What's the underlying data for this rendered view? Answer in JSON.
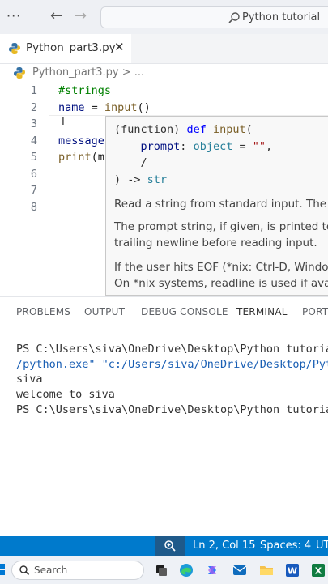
{
  "titlebar": {
    "menu_icon": "ellipsis-icon",
    "back_icon": "back-arrow-icon",
    "forward_icon": "forward-arrow-icon",
    "command_center_text": "Python tutorial"
  },
  "tabs": [
    {
      "label": "Python_part3.py",
      "active": true,
      "icon": "python-file-icon"
    }
  ],
  "breadcrumb": {
    "file": "Python_part3.py",
    "more": "> ..."
  },
  "editor": {
    "line_numbers": [
      "1",
      "2",
      "3",
      "4",
      "5",
      "6",
      "7",
      "8"
    ],
    "lines": {
      "l1": "#strings",
      "l2_var": "name",
      "l2_op": " = ",
      "l2_fn": "input",
      "l2_paren": "()",
      "l4": "message",
      "l5_fn": "print",
      "l5_rest": "(m"
    },
    "cursor_line": 2,
    "cursor_col": 15
  },
  "hover": {
    "sig": {
      "open_paren": "(",
      "kind": "function",
      "close_kind": ") ",
      "def_kw": "def",
      "fn_name": "input",
      "open": "(",
      "indent": "    ",
      "param": "prompt",
      "colon": ": ",
      "param_type": "object",
      "eq": " = ",
      "default": "\"\"",
      "comma": ",",
      "slash": "/",
      "close": ") -> ",
      "ret": "str"
    },
    "doc": [
      "Read a string from standard input. The t",
      "The prompt string, if given, is printed to",
      "trailing newline before reading input.",
      "If the user hits EOF (*nix: Ctrl-D, Window",
      "On *nix systems, readline is used if avail"
    ]
  },
  "panel": {
    "tabs": [
      "PROBLEMS",
      "OUTPUT",
      "DEBUG CONSOLE",
      "TERMINAL",
      "PORTS"
    ],
    "active_tab": "TERMINAL",
    "terminal": [
      "PS C:\\Users\\siva\\OneDrive\\Desktop\\Python tutoria",
      "/python.exe\" \"c:/Users/siva/OneDrive/Desktop/Pyt",
      "siva",
      "welcome to siva",
      "PS C:\\Users\\siva\\OneDrive\\Desktop\\Python tutoria"
    ]
  },
  "statusbar": {
    "zoom_icon": "zoom-in-icon",
    "position": "Ln 2, Col 15",
    "spaces": "Spaces: 4",
    "encoding": "UT",
    "color": "#007acc"
  },
  "taskbar": {
    "search_placeholder": "Search",
    "apps": [
      "task-view-icon",
      "edge-icon",
      "copilot-icon",
      "mail-icon",
      "file-explorer-icon",
      "word-icon",
      "excel-icon"
    ]
  }
}
